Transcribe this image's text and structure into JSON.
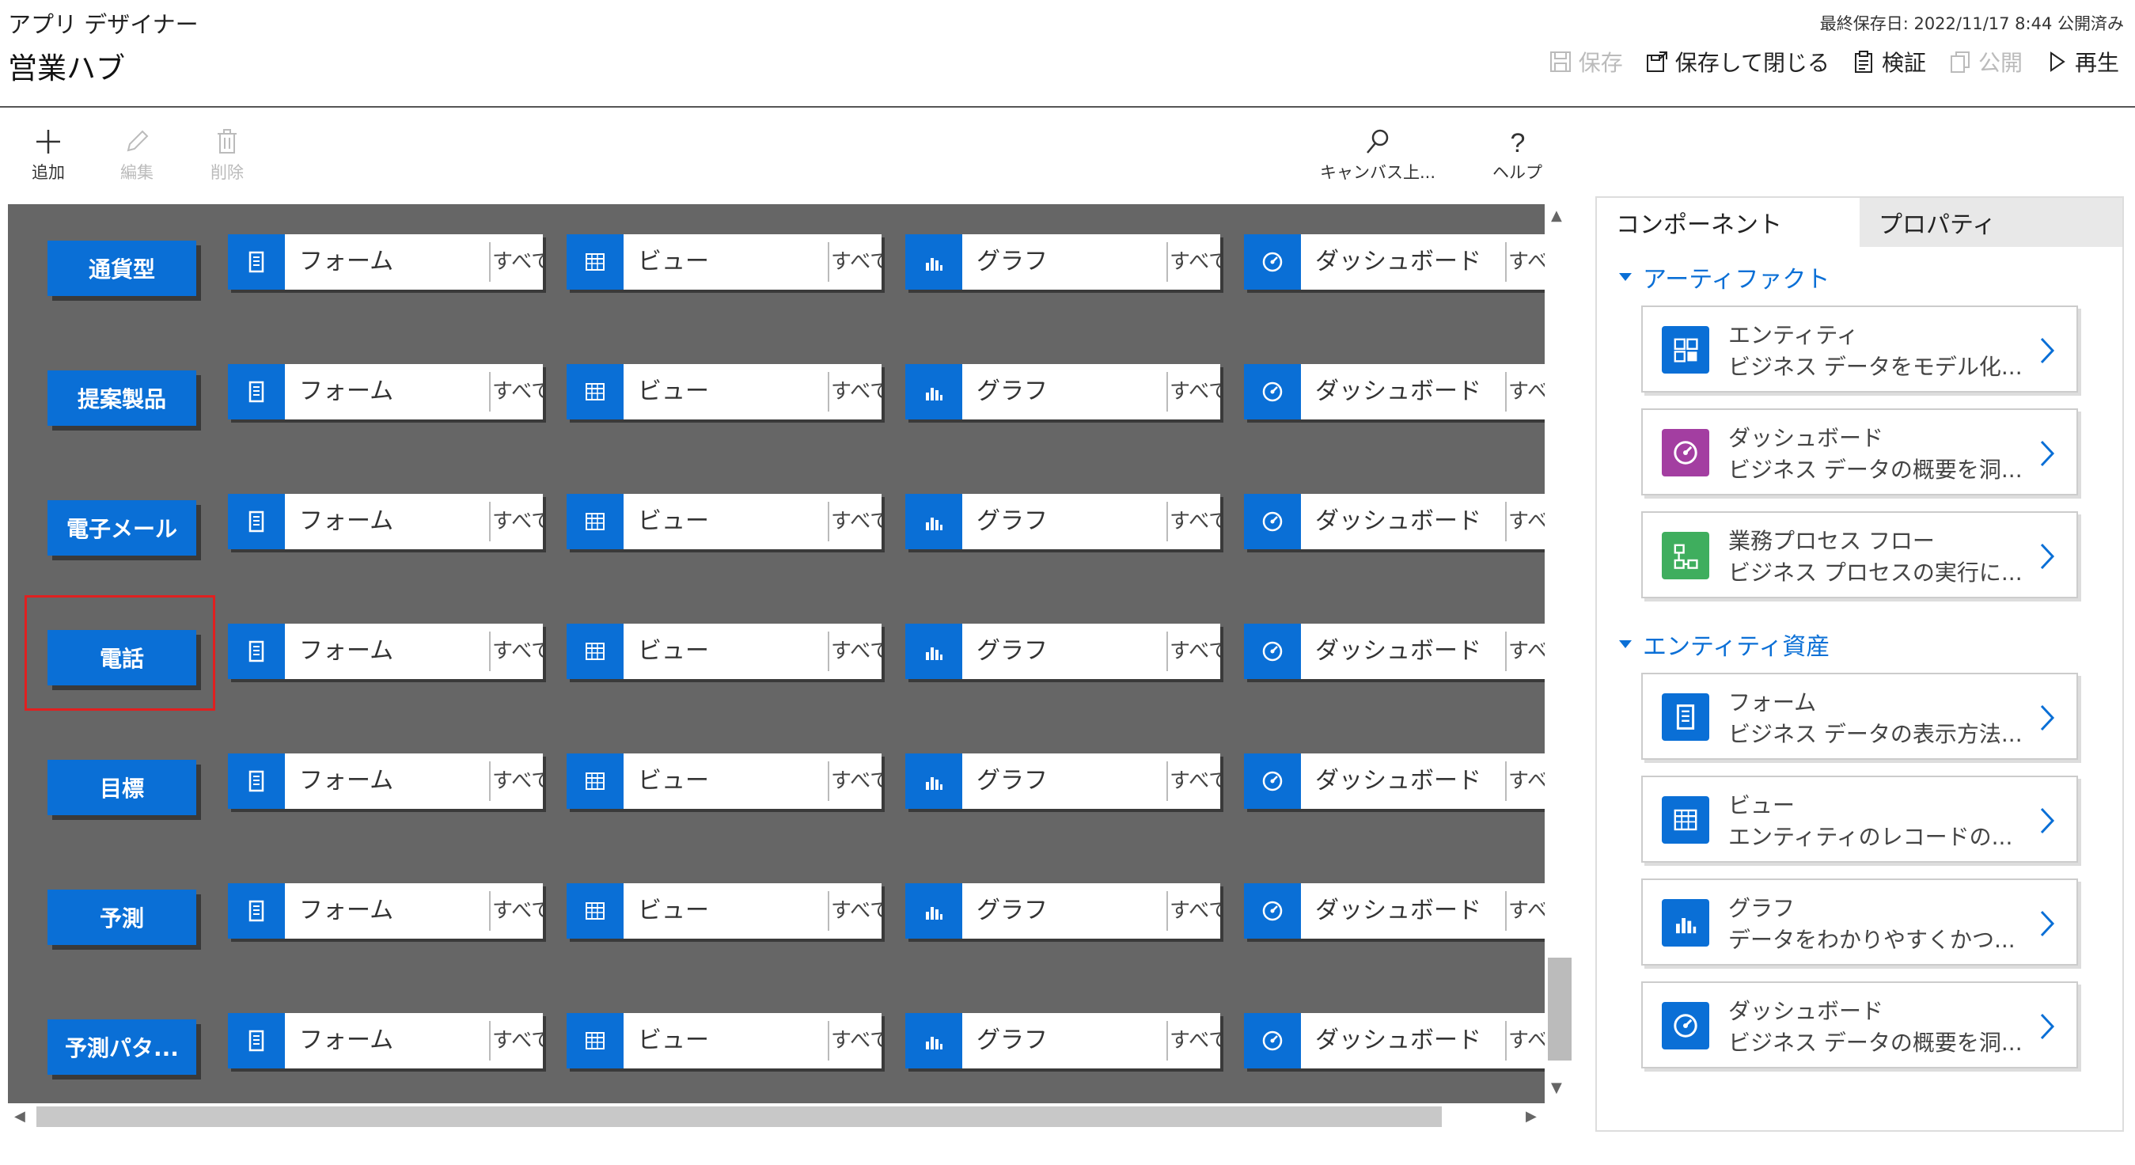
{
  "header": {
    "app_name": "アプリ デザイナー",
    "title": "営業ハブ",
    "last_saved": "最終保存日: 2022/11/17 8:44 公開済み",
    "actions": {
      "save": "保存",
      "save_close": "保存して閉じる",
      "validate": "検証",
      "publish": "公開",
      "play": "再生"
    }
  },
  "toolbar": {
    "add": "追加",
    "edit": "編集",
    "delete": "削除",
    "search": "キャンバス上...",
    "help": "ヘルプ"
  },
  "canvas": {
    "entities": [
      {
        "name": "通貨型",
        "selected": false
      },
      {
        "name": "提案製品",
        "selected": false
      },
      {
        "name": "電子メール",
        "selected": false
      },
      {
        "name": "電話",
        "selected": true
      },
      {
        "name": "目標",
        "selected": false
      },
      {
        "name": "予測",
        "selected": false
      },
      {
        "name": "予測パタ...",
        "selected": false
      }
    ],
    "tile_labels": {
      "form": "フォーム",
      "view": "ビュー",
      "chart": "グラフ",
      "dashboard": "ダッシュボード",
      "all": "すべて"
    }
  },
  "panel": {
    "tabs": {
      "components": "コンポーネント",
      "properties": "プロパティ"
    },
    "artifacts": {
      "title": "アーティファクト",
      "items": [
        {
          "title": "エンティティ",
          "desc": "ビジネス データをモデル化...",
          "icon": "entity-icon",
          "color": "#0a6fd6"
        },
        {
          "title": "ダッシュボード",
          "desc": "ビジネス データの概要を洞...",
          "icon": "dashboard-icon",
          "color": "#a33ea1"
        },
        {
          "title": "業務プロセス フロー",
          "desc": "ビジネス プロセスの実行に...",
          "icon": "process-flow-icon",
          "color": "#3fae5e"
        }
      ]
    },
    "entity_assets": {
      "title": "エンティティ資産",
      "items": [
        {
          "title": "フォーム",
          "desc": "ビジネス データの表示方法...",
          "icon": "form-icon",
          "color": "#0a6fd6"
        },
        {
          "title": "ビュー",
          "desc": "エンティティのレコードの...",
          "icon": "view-icon",
          "color": "#0a6fd6"
        },
        {
          "title": "グラフ",
          "desc": "データをわかりやすくかつ...",
          "icon": "chart-icon",
          "color": "#0a6fd6"
        },
        {
          "title": "ダッシュボード",
          "desc": "ビジネス データの概要を洞...",
          "icon": "dashboard-icon",
          "color": "#0a6fd6"
        }
      ]
    }
  },
  "colors": {
    "accent": "#0a6fd6",
    "canvas": "#666666",
    "selection": "#e02020"
  }
}
